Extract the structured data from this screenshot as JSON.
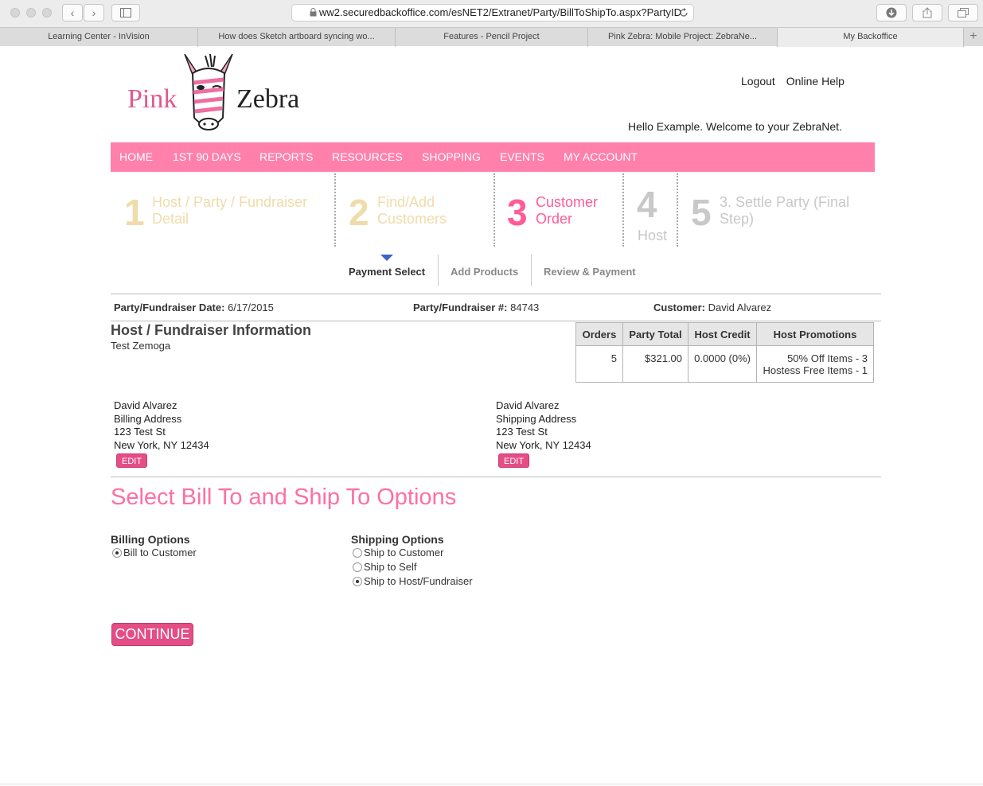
{
  "browser": {
    "url": "ww2.securedbackoffice.com/esNET2/Extranet/Party/BillToShipTo.aspx?PartyID",
    "tabs": [
      {
        "title": "Learning Center - InVision"
      },
      {
        "title": "How does Sketch artboard syncing wo..."
      },
      {
        "title": "Features - Pencil Project"
      },
      {
        "title": "Pink Zebra: Mobile Project: ZebraNe..."
      },
      {
        "title": "My Backoffice"
      }
    ],
    "back_glyph": "‹",
    "forward_glyph": "›",
    "plus_glyph": "+"
  },
  "header": {
    "logo_pink": "Pink",
    "logo_zebra": "Zebra",
    "logout": "Logout",
    "online_help": "Online Help",
    "welcome": "Hello Example. Welcome to your ZebraNet."
  },
  "nav": {
    "items": [
      "HOME",
      "1ST 90 DAYS",
      "REPORTS",
      "RESOURCES",
      "SHOPPING",
      "EVENTS",
      "MY ACCOUNT"
    ]
  },
  "steps": [
    {
      "num": "1",
      "label1": "Host / Party / Fundraiser",
      "label2": "Detail"
    },
    {
      "num": "2",
      "label1": "Find/Add",
      "label2": "Customers"
    },
    {
      "num": "3",
      "label1": "Customer",
      "label2": "Order"
    },
    {
      "num": "4",
      "label1": "Host",
      "label2": ""
    },
    {
      "num": "5",
      "label1": "3. Settle Party (Final",
      "label2": "Step)"
    }
  ],
  "subtabs": [
    "Payment Select",
    "Add Products",
    "Review & Payment"
  ],
  "party_info": {
    "date_label": "Party/Fundraiser Date:",
    "date_value": "6/17/2015",
    "number_label": "Party/Fundraiser #:",
    "number_value": "84743",
    "customer_label": "Customer:",
    "customer_value": "David Alvarez"
  },
  "host": {
    "title": "Host / Fundraiser Information",
    "name": "Test Zemoga"
  },
  "stats": {
    "headers": [
      "Orders",
      "Party Total",
      "Host Credit",
      "Host Promotions"
    ],
    "orders": "5",
    "party_total": "$321.00",
    "host_credit": "0.0000 (0%)",
    "promo1": "50% Off Items - 3",
    "promo2": "Hostess Free Items - 1"
  },
  "billing_address": {
    "name": "David Alvarez",
    "label": "Billing Address",
    "street": "123 Test St",
    "city": "New York, NY 12434",
    "edit": "EDIT"
  },
  "shipping_address": {
    "name": "David Alvarez",
    "label": "Shipping Address",
    "street": "123 Test St",
    "city": "New York, NY 12434",
    "edit": "EDIT"
  },
  "options": {
    "title": "Select Bill To and Ship To Options",
    "billing_heading": "Billing Options",
    "billing": [
      {
        "label": "Bill to Customer",
        "selected": true
      }
    ],
    "shipping_heading": "Shipping Options",
    "shipping": [
      {
        "label": "Ship to Customer",
        "selected": false
      },
      {
        "label": "Ship to Self",
        "selected": false
      },
      {
        "label": "Ship to Host/Fundraiser",
        "selected": true
      }
    ]
  },
  "continue_label": "CONTINUE",
  "colors": {
    "accent": "#ff80ab",
    "button": "#e44d85",
    "step_inactive": "#f0dcaa",
    "step_active": "#ff5c97",
    "step_future": "#c8c8c8"
  }
}
